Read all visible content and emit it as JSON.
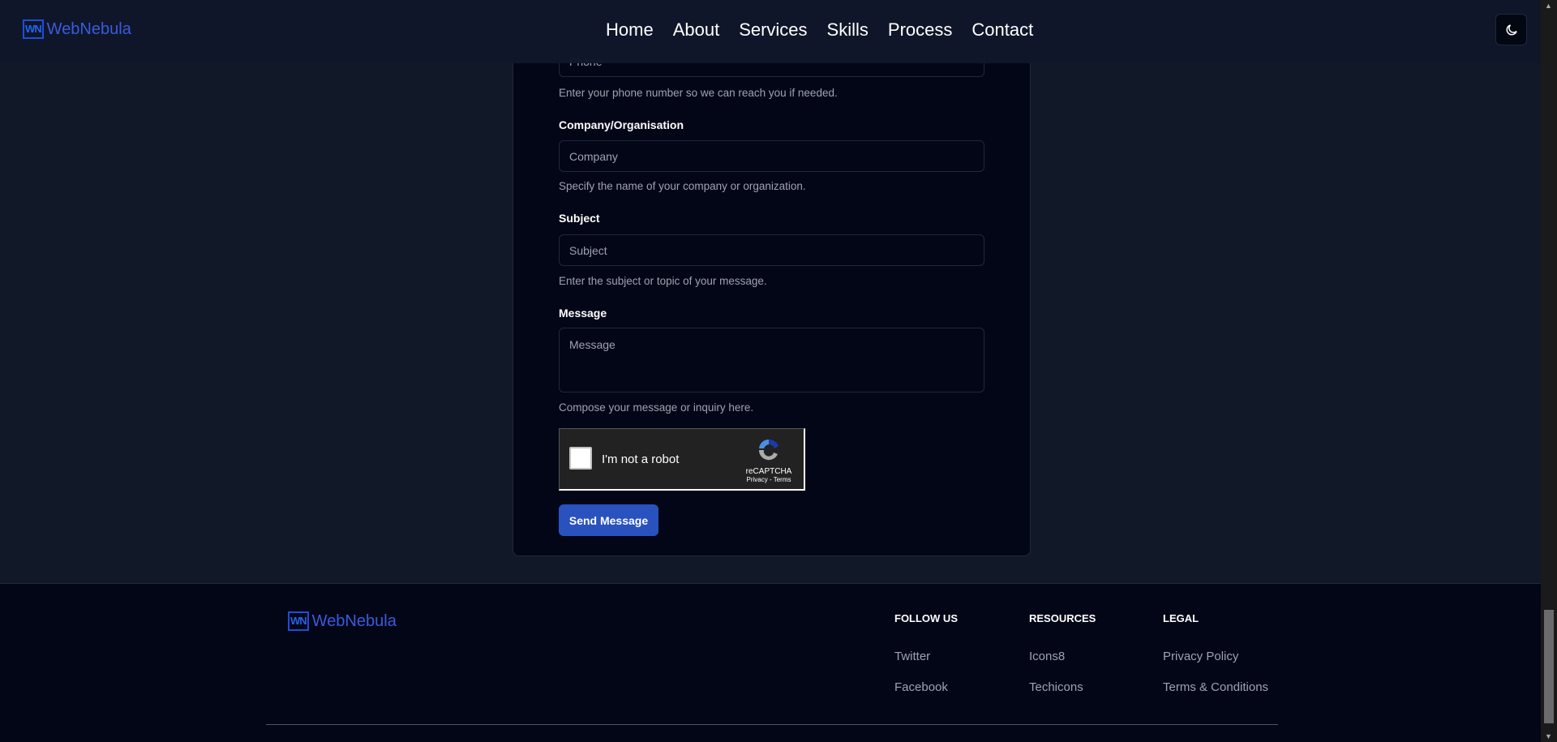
{
  "nav": {
    "logo_mark": "WN",
    "logo_text": "WebNebula",
    "links": [
      "Home",
      "About",
      "Services",
      "Skills",
      "Process",
      "Contact"
    ],
    "theme_icon": "moon-icon"
  },
  "form": {
    "phone": {
      "placeholder": "Phone",
      "help": "Enter your phone number so we can reach you if needed."
    },
    "company": {
      "label": "Company/Organisation",
      "placeholder": "Company",
      "help": "Specify the name of your company or organization."
    },
    "subject": {
      "label": "Subject",
      "placeholder": "Subject",
      "help": "Enter the subject or topic of your message."
    },
    "message": {
      "label": "Message",
      "placeholder": "Message",
      "help": "Compose your message or inquiry here."
    },
    "captcha": {
      "label": "I'm not a robot",
      "brand": "reCAPTCHA",
      "links": "Privacy - Terms"
    },
    "submit": "Send Message"
  },
  "footer": {
    "logo_mark": "WN",
    "logo_text": "WebNebula",
    "columns": [
      {
        "title": "FOLLOW US",
        "links": [
          "Twitter",
          "Facebook"
        ]
      },
      {
        "title": "RESOURCES",
        "links": [
          "Icons8",
          "Techicons"
        ]
      },
      {
        "title": "LEGAL",
        "links": [
          "Privacy Policy",
          "Terms & Conditions"
        ]
      }
    ]
  },
  "colors": {
    "accent": "#2a52be",
    "background": "#111827",
    "card": "#030617"
  }
}
